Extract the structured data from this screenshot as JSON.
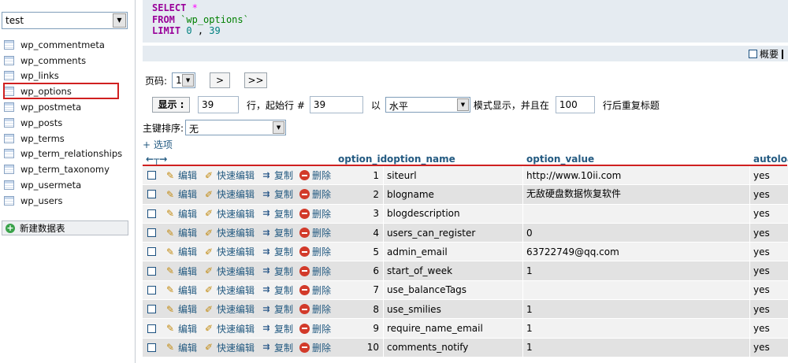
{
  "nav": {
    "database": "test",
    "tables": [
      "wp_commentmeta",
      "wp_comments",
      "wp_links",
      "wp_options",
      "wp_postmeta",
      "wp_posts",
      "wp_terms",
      "wp_term_relationships",
      "wp_term_taxonomy",
      "wp_usermeta",
      "wp_users"
    ],
    "selected": "wp_options",
    "new_table_label": "新建数据表"
  },
  "sql": {
    "line1_kw": "SELECT",
    "line1_sym": "*",
    "line2_kw": "FROM",
    "line2_table": "`wp_options`",
    "line3_kw": "LIMIT",
    "line3_a": "0",
    "line3_sep": ",",
    "line3_b": "39"
  },
  "profile_label": "概要",
  "pager": {
    "page_label": "页码:",
    "page_value": "1",
    "next_label": ">",
    "last_label": ">>"
  },
  "show_row": {
    "show_button": "显示 :",
    "rows_value": "39",
    "rows_text": "行，起始行 #",
    "start_value": "39",
    "in_text": "以",
    "mode_value": "水平",
    "mode_text": "模式显示，并且在",
    "repeat_value": "100",
    "repeat_text": "行后重复标题"
  },
  "sort": {
    "label": "主键排序:",
    "value": "无"
  },
  "options_link": "+ 选项",
  "table": {
    "arrows": "←┬→",
    "columns": [
      "option_id",
      "option_name",
      "option_value",
      "autoload"
    ],
    "actions": {
      "edit": "编辑",
      "quick_edit": "快速编辑",
      "copy": "复制",
      "delete": "删除"
    },
    "rows": [
      {
        "id": "1",
        "name": "siteurl",
        "value": "http://www.10ii.com",
        "autoload": "yes"
      },
      {
        "id": "2",
        "name": "blogname",
        "value": "无敌硬盘数据恢复软件",
        "autoload": "yes"
      },
      {
        "id": "3",
        "name": "blogdescription",
        "value": "",
        "autoload": "yes"
      },
      {
        "id": "4",
        "name": "users_can_register",
        "value": "0",
        "autoload": "yes"
      },
      {
        "id": "5",
        "name": "admin_email",
        "value": "63722749@qq.com",
        "autoload": "yes"
      },
      {
        "id": "6",
        "name": "start_of_week",
        "value": "1",
        "autoload": "yes"
      },
      {
        "id": "7",
        "name": "use_balanceTags",
        "value": "",
        "autoload": "yes"
      },
      {
        "id": "8",
        "name": "use_smilies",
        "value": "1",
        "autoload": "yes"
      },
      {
        "id": "9",
        "name": "require_name_email",
        "value": "1",
        "autoload": "yes"
      },
      {
        "id": "10",
        "name": "comments_notify",
        "value": "1",
        "autoload": "yes"
      }
    ]
  },
  "colors": {
    "highlight": "#d02020",
    "link": "#235a81",
    "sql_bg": "#e5ebf1"
  }
}
